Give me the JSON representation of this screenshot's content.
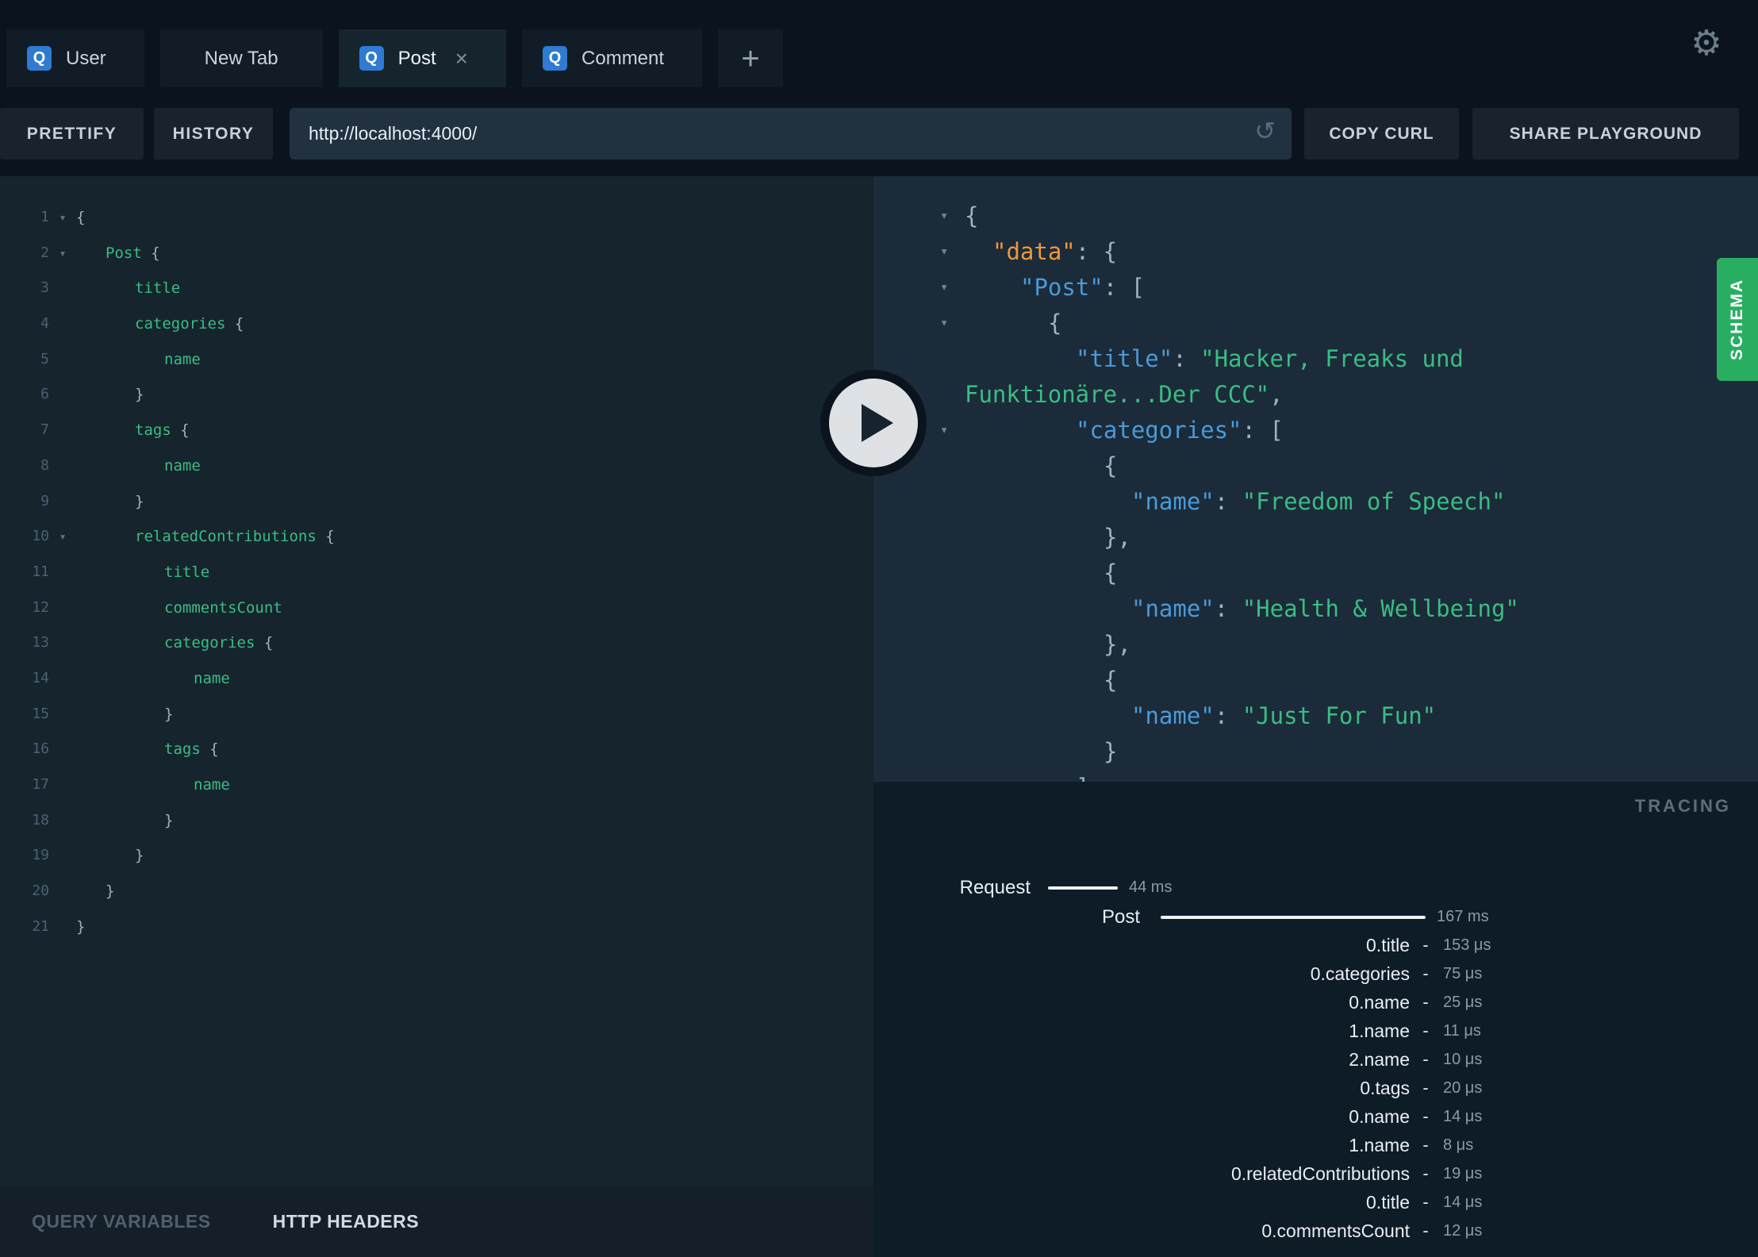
{
  "topbar": {
    "tabs": [
      {
        "label": "User",
        "has_icon": true,
        "active": false,
        "closable": false
      },
      {
        "label": "New Tab",
        "has_icon": false,
        "active": false,
        "closable": false
      },
      {
        "label": "Post",
        "has_icon": true,
        "active": true,
        "closable": true
      },
      {
        "label": "Comment",
        "has_icon": true,
        "active": false,
        "closable": false
      }
    ],
    "add_tab_label": "+"
  },
  "icons": {
    "query_badge": "Q",
    "close": "×",
    "settings_gear": "⚙",
    "reload": "↺",
    "fold_arrow": "▾"
  },
  "toolbar": {
    "prettify_label": "PRETTIFY",
    "history_label": "HISTORY",
    "url_value": "http://localhost:4000/",
    "copy_curl_label": "COPY CURL",
    "share_label": "SHARE PLAYGROUND"
  },
  "editor": {
    "lines": [
      {
        "n": 1,
        "fold": true,
        "i": 0,
        "s": [
          [
            "p",
            "{"
          ]
        ]
      },
      {
        "n": 2,
        "fold": true,
        "i": 1,
        "s": [
          [
            "f",
            "Post"
          ],
          [
            "p",
            " {"
          ]
        ]
      },
      {
        "n": 3,
        "fold": false,
        "i": 2,
        "s": [
          [
            "f",
            "title"
          ]
        ]
      },
      {
        "n": 4,
        "fold": false,
        "i": 2,
        "s": [
          [
            "f",
            "categories"
          ],
          [
            "p",
            " {"
          ]
        ]
      },
      {
        "n": 5,
        "fold": false,
        "i": 3,
        "s": [
          [
            "f",
            "name"
          ]
        ]
      },
      {
        "n": 6,
        "fold": false,
        "i": 2,
        "s": [
          [
            "p",
            "}"
          ]
        ]
      },
      {
        "n": 7,
        "fold": false,
        "i": 2,
        "s": [
          [
            "f",
            "tags"
          ],
          [
            "p",
            " {"
          ]
        ]
      },
      {
        "n": 8,
        "fold": false,
        "i": 3,
        "s": [
          [
            "f",
            "name"
          ]
        ]
      },
      {
        "n": 9,
        "fold": false,
        "i": 2,
        "s": [
          [
            "p",
            "}"
          ]
        ]
      },
      {
        "n": 10,
        "fold": true,
        "i": 2,
        "s": [
          [
            "f",
            "relatedContributions"
          ],
          [
            "p",
            " {"
          ]
        ]
      },
      {
        "n": 11,
        "fold": false,
        "i": 3,
        "s": [
          [
            "f",
            "title"
          ]
        ]
      },
      {
        "n": 12,
        "fold": false,
        "i": 3,
        "s": [
          [
            "f",
            "commentsCount"
          ]
        ]
      },
      {
        "n": 13,
        "fold": false,
        "i": 3,
        "s": [
          [
            "f",
            "categories"
          ],
          [
            "p",
            " {"
          ]
        ]
      },
      {
        "n": 14,
        "fold": false,
        "i": 4,
        "s": [
          [
            "f",
            "name"
          ]
        ]
      },
      {
        "n": 15,
        "fold": false,
        "i": 3,
        "s": [
          [
            "p",
            "}"
          ]
        ]
      },
      {
        "n": 16,
        "fold": false,
        "i": 3,
        "s": [
          [
            "f",
            "tags"
          ],
          [
            "p",
            " {"
          ]
        ]
      },
      {
        "n": 17,
        "fold": false,
        "i": 4,
        "s": [
          [
            "f",
            "name"
          ]
        ]
      },
      {
        "n": 18,
        "fold": false,
        "i": 3,
        "s": [
          [
            "p",
            "}"
          ]
        ]
      },
      {
        "n": 19,
        "fold": false,
        "i": 2,
        "s": [
          [
            "p",
            "}"
          ]
        ]
      },
      {
        "n": 20,
        "fold": false,
        "i": 1,
        "s": [
          [
            "p",
            "}"
          ]
        ]
      },
      {
        "n": 21,
        "fold": false,
        "i": 0,
        "s": [
          [
            "p",
            "}"
          ]
        ]
      }
    ]
  },
  "response": {
    "lines": [
      {
        "fold": true,
        "i": 0,
        "s": [
          [
            "p",
            "{"
          ]
        ]
      },
      {
        "fold": true,
        "i": 1,
        "s": [
          [
            "kd",
            "\"data\""
          ],
          [
            "p",
            ": {"
          ]
        ]
      },
      {
        "fold": true,
        "i": 2,
        "s": [
          [
            "k",
            "\"Post\""
          ],
          [
            "p",
            ": ["
          ]
        ]
      },
      {
        "fold": true,
        "i": 3,
        "s": [
          [
            "p",
            "{"
          ]
        ]
      },
      {
        "fold": false,
        "i": 4,
        "wrap": true,
        "s": [
          [
            "k",
            "\"title\""
          ],
          [
            "p",
            ": "
          ],
          [
            "str",
            "\"Hacker, Freaks und Funktionäre...Der CCC\""
          ],
          [
            "p",
            ","
          ]
        ]
      },
      {
        "fold": true,
        "i": 4,
        "s": [
          [
            "k",
            "\"categories\""
          ],
          [
            "p",
            ": ["
          ]
        ]
      },
      {
        "fold": false,
        "i": 5,
        "s": [
          [
            "p",
            "{"
          ]
        ]
      },
      {
        "fold": false,
        "i": 6,
        "s": [
          [
            "k",
            "\"name\""
          ],
          [
            "p",
            ": "
          ],
          [
            "str",
            "\"Freedom of Speech\""
          ]
        ]
      },
      {
        "fold": false,
        "i": 5,
        "s": [
          [
            "p",
            "},"
          ]
        ]
      },
      {
        "fold": false,
        "i": 5,
        "s": [
          [
            "p",
            "{"
          ]
        ]
      },
      {
        "fold": false,
        "i": 6,
        "s": [
          [
            "k",
            "\"name\""
          ],
          [
            "p",
            ": "
          ],
          [
            "str",
            "\"Health & Wellbeing\""
          ]
        ]
      },
      {
        "fold": false,
        "i": 5,
        "s": [
          [
            "p",
            "},"
          ]
        ]
      },
      {
        "fold": false,
        "i": 5,
        "s": [
          [
            "p",
            "{"
          ]
        ]
      },
      {
        "fold": false,
        "i": 6,
        "s": [
          [
            "k",
            "\"name\""
          ],
          [
            "p",
            ": "
          ],
          [
            "str",
            "\"Just For Fun\""
          ]
        ]
      },
      {
        "fold": false,
        "i": 5,
        "s": [
          [
            "p",
            "}"
          ]
        ]
      },
      {
        "fold": false,
        "i": 4,
        "s": [
          [
            "p",
            "],"
          ]
        ]
      }
    ]
  },
  "footer": {
    "query_variables_label": "QUERY VARIABLES",
    "http_headers_label": "HTTP HEADERS"
  },
  "schema_tab_label": "SCHEMA",
  "tracing": {
    "title": "TRACING",
    "spans": [
      {
        "label": "Request",
        "ms": 44,
        "duration_label": "44 ms"
      },
      {
        "label": "Post",
        "ms": 167,
        "duration_label": "167 ms"
      }
    ],
    "resolvers": [
      {
        "path": "0.title",
        "duration": "153 μs"
      },
      {
        "path": "0.categories",
        "duration": "75 μs"
      },
      {
        "path": "0.name",
        "duration": "25 μs"
      },
      {
        "path": "1.name",
        "duration": "11 μs"
      },
      {
        "path": "2.name",
        "duration": "10 μs"
      },
      {
        "path": "0.tags",
        "duration": "20 μs"
      },
      {
        "path": "0.name",
        "duration": "14 μs"
      },
      {
        "path": "1.name",
        "duration": "8 μs"
      },
      {
        "path": "0.relatedContributions",
        "duration": "19 μs"
      },
      {
        "path": "0.title",
        "duration": "14 μs"
      },
      {
        "path": "0.commentsCount",
        "duration": "12 μs"
      }
    ]
  }
}
